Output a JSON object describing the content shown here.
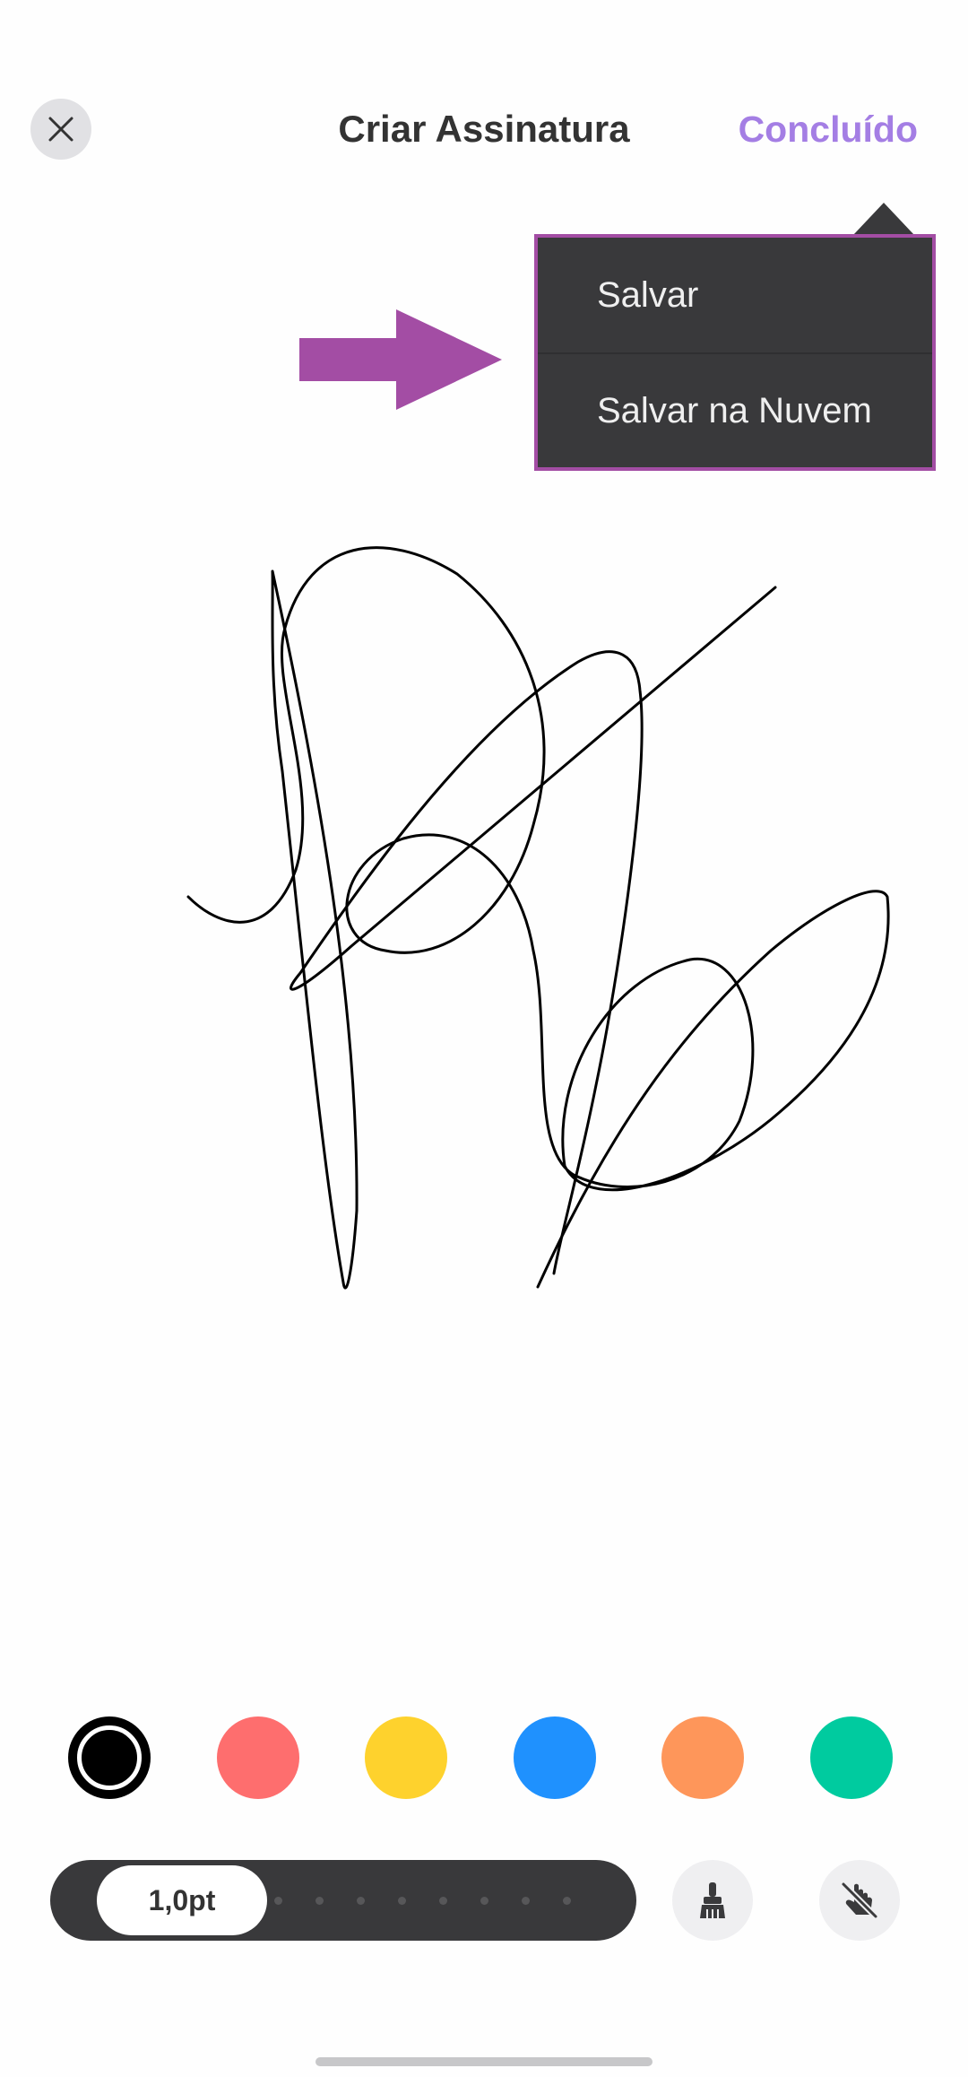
{
  "header": {
    "title": "Criar Assinatura",
    "done_label": "Concluído",
    "close_icon": "close-icon"
  },
  "popup_menu": {
    "items": [
      {
        "label": "Salvar"
      },
      {
        "label": "Salvar na Nuvem"
      }
    ]
  },
  "annotation": {
    "icon": "arrow-right-icon",
    "color": "#a34da4"
  },
  "palette": {
    "selected": "#000000",
    "colors": [
      "#000000",
      "#fe6e6e",
      "#fed22d",
      "#1f91fe",
      "#fe965a",
      "#00cb9f"
    ]
  },
  "toolbar": {
    "stroke_width_label": "1,0pt",
    "eraser_icon": "brush-icon",
    "stylus_icon": "hand-stylus-off-icon"
  },
  "colors": {
    "accent": "#a47ee4",
    "menu_background": "#39393b",
    "stroke": "#000000"
  }
}
